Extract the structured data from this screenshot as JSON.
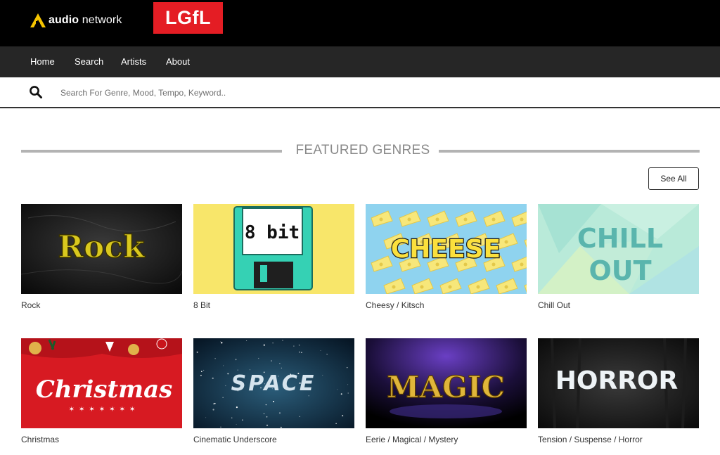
{
  "header": {
    "brand": {
      "bold": "audio",
      "rest": " network"
    },
    "partner_logo": "LGfL"
  },
  "nav": {
    "items": [
      {
        "label": "Home"
      },
      {
        "label": "Search"
      },
      {
        "label": "Artists"
      },
      {
        "label": "About"
      }
    ]
  },
  "search": {
    "placeholder": "Search For Genre, Mood, Tempo, Keyword.."
  },
  "featured": {
    "title": "FEATURED GENRES",
    "see_all": "See All",
    "genres": [
      {
        "label": "Rock",
        "thumb_text": "Rock"
      },
      {
        "label": "8 Bit",
        "thumb_text": "8 bit"
      },
      {
        "label": "Cheesy / Kitsch",
        "thumb_text": "CHEESE"
      },
      {
        "label": "Chill Out",
        "thumb_text": [
          "CHILL",
          "OUT"
        ]
      },
      {
        "label": "Christmas",
        "thumb_text": "Christmas"
      },
      {
        "label": "Cinematic Underscore",
        "thumb_text": "SPACE"
      },
      {
        "label": "Eerie / Magical / Mystery",
        "thumb_text": "MAGIC"
      },
      {
        "label": "Tension / Suspense / Horror",
        "thumb_text": "HORROR"
      }
    ]
  },
  "colors": {
    "header_bg": "#000000",
    "nav_bg": "#262626",
    "partner_red": "#e41d24",
    "brand_yellow": "#f5c400"
  }
}
